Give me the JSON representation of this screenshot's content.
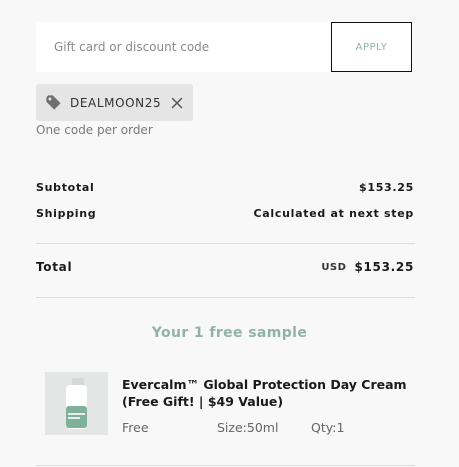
{
  "discount": {
    "placeholder": "Gift card or discount code",
    "apply_label": "APPLY",
    "applied_code": "DEALMOON25",
    "note": "One code per order"
  },
  "summary": {
    "subtotal_label": "Subtotal",
    "subtotal_value": "$153.25",
    "shipping_label": "Shipping",
    "shipping_value": "Calculated at next step",
    "total_label": "Total",
    "total_currency": "USD",
    "total_value": "$153.25"
  },
  "samples": {
    "heading": "Your 1 free sample",
    "items": [
      {
        "title": "Evercalm™ Global Protection Day Cream (Free Gift! | $49 Value)",
        "price": "Free",
        "size_label": "Size:",
        "size_value": "50ml",
        "qty_label": "Qty:",
        "qty_value": "1"
      }
    ]
  },
  "colors": {
    "accent": "#8fb3a6",
    "background": "#f8f8f8",
    "chip_background": "#e5e5e5"
  },
  "icons": {
    "tag": "tag-icon",
    "remove": "close-icon"
  }
}
